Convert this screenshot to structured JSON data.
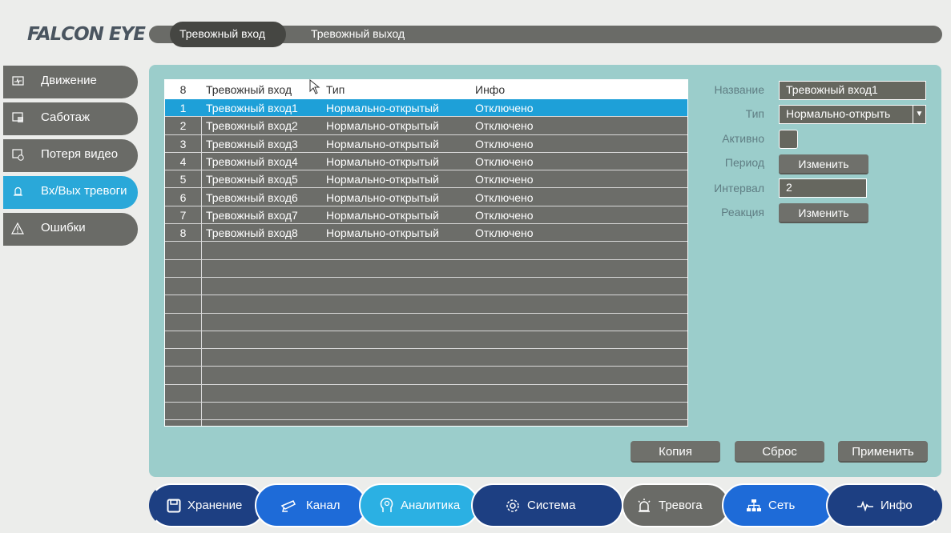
{
  "brand": {
    "logo_text": "FALCON EYE"
  },
  "top_tabs": [
    {
      "label": "Тревожный вход",
      "active": true
    },
    {
      "label": "Тревожный выход",
      "active": false
    }
  ],
  "sidebar": {
    "items": [
      {
        "label": "Движение",
        "icon": "motion-icon",
        "active": false
      },
      {
        "label": "Саботаж",
        "icon": "tamper-icon",
        "active": false
      },
      {
        "label": "Потеря видео",
        "icon": "video-loss-icon",
        "active": false
      },
      {
        "label": "Вх/Вых тревоги",
        "icon": "alarm-io-icon",
        "active": true
      },
      {
        "label": "Ошибки",
        "icon": "warning-icon",
        "active": false
      }
    ]
  },
  "table": {
    "headers": [
      "8",
      "Тревожный вход",
      "Тип",
      "Инфо"
    ],
    "rows": [
      [
        "1",
        "Тревожный вход1",
        "Нормально-открытый",
        "Отключено"
      ],
      [
        "2",
        "Тревожный вход2",
        "Нормально-открытый",
        "Отключено"
      ],
      [
        "3",
        "Тревожный вход3",
        "Нормально-открытый",
        "Отключено"
      ],
      [
        "4",
        "Тревожный вход4",
        "Нормально-открытый",
        "Отключено"
      ],
      [
        "5",
        "Тревожный вход5",
        "Нормально-открытый",
        "Отключено"
      ],
      [
        "6",
        "Тревожный вход6",
        "Нормально-открытый",
        "Отключено"
      ],
      [
        "7",
        "Тревожный вход7",
        "Нормально-открытый",
        "Отключено"
      ],
      [
        "8",
        "Тревожный вход8",
        "Нормально-открытый",
        "Отключено"
      ]
    ],
    "selected_row": 1
  },
  "form": {
    "name_label": "Название",
    "name_value": "Тревожный вход1",
    "type_label": "Тип",
    "type_value": "Нормально-открыть",
    "active_label": "Активно",
    "period_label": "Период",
    "period_button": "Изменить",
    "interval_label": "Интервал",
    "interval_value": "2",
    "reaction_label": "Реакция",
    "reaction_button": "Изменить"
  },
  "actions": {
    "copy": "Копия",
    "reset": "Сброс",
    "apply": "Применить"
  },
  "bottom_nav": [
    {
      "label": "Хранение",
      "icon": "save-icon"
    },
    {
      "label": "Канал",
      "icon": "camera-icon"
    },
    {
      "label": "Аналитика",
      "icon": "analytics-icon"
    },
    {
      "label": "Система",
      "icon": "gear-icon"
    },
    {
      "label": "Тревога",
      "icon": "alarm-icon"
    },
    {
      "label": "Сеть",
      "icon": "network-icon"
    },
    {
      "label": "Инфо",
      "icon": "pulse-icon"
    }
  ],
  "colors": {
    "accent": "#2aa8d9",
    "panel": "#9bcdcb",
    "table_bg": "#6c6d69",
    "nav_dark": "#1d3f82",
    "nav_blue": "#1e6bd8"
  }
}
